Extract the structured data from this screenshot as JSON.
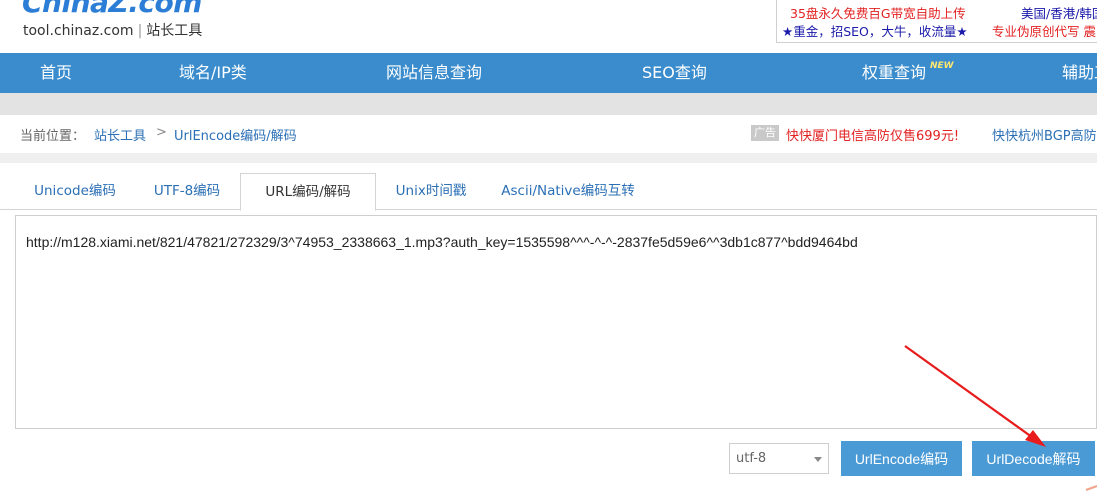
{
  "header": {
    "logo": "ChinaZ.com",
    "logo_domain": "tool.chinaz.com",
    "logo_separator": "|",
    "logo_tagline": "站长工具",
    "ads": {
      "line1_left": "35盘永久免费百G带宽自助上传",
      "line1_right": "美国/香港/韩国",
      "line2_left": "★重金，招SEO，大牛，收流量★",
      "line2_right": "专业伪原创代写 震"
    }
  },
  "nav": {
    "items": [
      "首页",
      "域名/IP类",
      "网站信息查询",
      "SEO查询",
      "权重查询",
      "辅助工"
    ],
    "new_badge": "NEW"
  },
  "breadcrumb": {
    "label": "当前位置：",
    "home": "站长工具",
    "separator": ">",
    "current": "UrlEncode编码/解码"
  },
  "promo": {
    "badge": "广告",
    "red_text": "快快厦门电信高防仅售699元!",
    "blue_text": "快快杭州BGP高防"
  },
  "tabs": [
    "Unicode编码",
    "UTF-8编码",
    "URL编码/解码",
    "Unix时间戳",
    "Ascii/Native编码互转"
  ],
  "active_tab": "URL编码/解码",
  "input": {
    "value": "http://m128.xiami.net/821/47821/272329/3^74953_2338663_1.mp3?auth_key=1535598^^^-^-^-2837fe5d59e6^^3db1c877^bdd9464bd"
  },
  "controls": {
    "charset_selected": "utf-8",
    "encode_label": "UrlEncode编码",
    "decode_label": "UrlDecode解码"
  },
  "colors": {
    "nav_bg": "#3a8ccd",
    "button_bg": "#4a9ad6",
    "link": "#2b6fb5",
    "promo_red": "#e32222",
    "annotation_arrow": "#e81c1c"
  }
}
